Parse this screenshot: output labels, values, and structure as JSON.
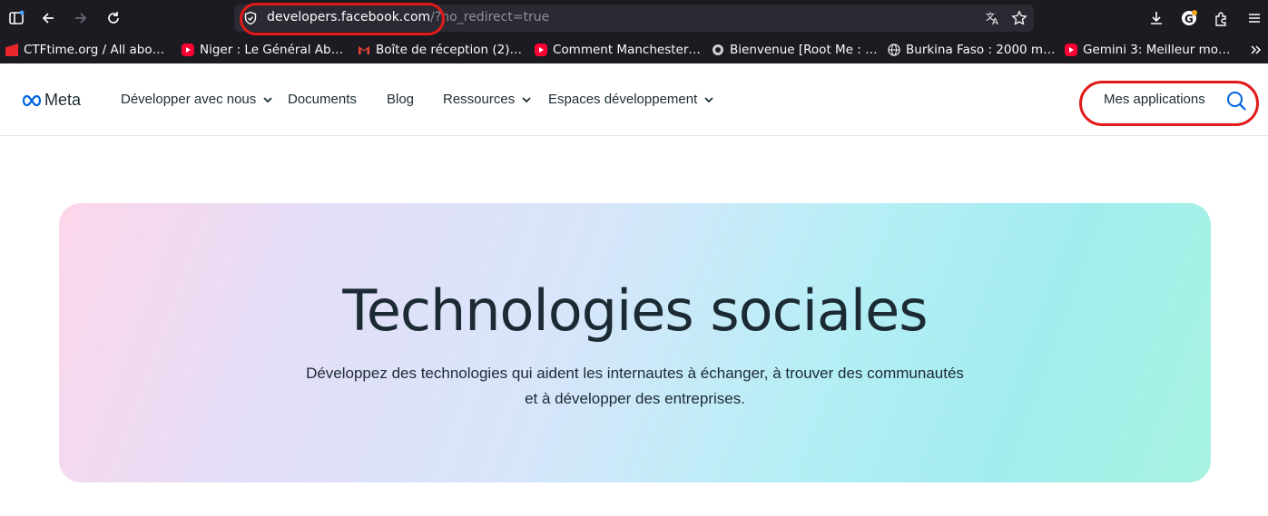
{
  "browser": {
    "url_host": "developers.facebook.com",
    "url_path": "/?no_redirect=true",
    "bookmarks": [
      {
        "label": "CTFtime.org / All abo…",
        "icon": "ctftime-icon"
      },
      {
        "label": "Niger : Le Général Ab…",
        "icon": "youtube-icon"
      },
      {
        "label": "Boîte de réception (2)…",
        "icon": "gmail-icon"
      },
      {
        "label": "Comment Manchester…",
        "icon": "youtube-icon"
      },
      {
        "label": "Bienvenue [Root Me : …",
        "icon": "rootme-icon"
      },
      {
        "label": "Burkina Faso : 2000 m…",
        "icon": "globe-icon"
      },
      {
        "label": "Gemini 3: Meilleur mo…",
        "icon": "youtube-icon"
      }
    ]
  },
  "nav": {
    "logo": "Meta",
    "items": [
      {
        "label": "Développer avec nous",
        "has_dropdown": true
      },
      {
        "label": "Documents",
        "has_dropdown": false
      },
      {
        "label": "Blog",
        "has_dropdown": false
      },
      {
        "label": "Ressources",
        "has_dropdown": true
      },
      {
        "label": "Espaces développement",
        "has_dropdown": true
      }
    ],
    "my_apps": "Mes applications"
  },
  "hero": {
    "title": "Technologies sociales",
    "subtitle": "Développez des technologies qui aident les internautes à échanger, à trouver des communautés et à développer des entreprises."
  },
  "colors": {
    "annotation_red": "#e21a1a",
    "meta_blue": "#0064e0",
    "text_dark": "#1c2b33"
  }
}
